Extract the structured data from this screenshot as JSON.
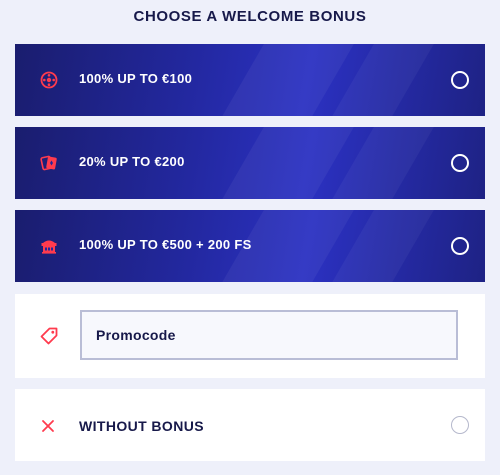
{
  "heading": "CHOOSE A WELCOME BONUS",
  "bonuses": [
    {
      "label": "100% UP TO €100",
      "icon": "roulette-wheel-icon"
    },
    {
      "label": "20% UP TO €200",
      "icon": "playing-cards-icon"
    },
    {
      "label": "100% UP TO €500 + 200 FS",
      "icon": "slot-machine-icon"
    }
  ],
  "promo": {
    "placeholder": "Promocode",
    "icon": "tag-icon"
  },
  "without_bonus": {
    "label": "WITHOUT BONUS",
    "icon": "close-icon"
  },
  "colors": {
    "accent": "#ff3b4e",
    "card": "#22279c",
    "text_dark": "#17194a"
  }
}
